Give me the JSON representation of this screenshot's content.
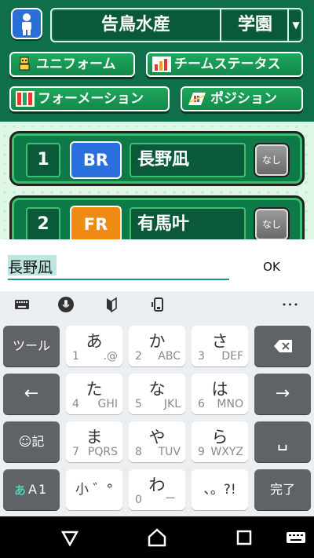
{
  "team": {
    "name": "告鳥水産",
    "division": "学園",
    "dropdown_glyph": "▼"
  },
  "menu": {
    "uniform": "ユニフォーム",
    "team_status": "チームステータス",
    "formation": "フォーメーション",
    "position": "ポジション"
  },
  "players": [
    {
      "number": "1",
      "position": "BR",
      "position_color": "#2a6fe0",
      "name": "長野凪",
      "none_label": "なし"
    },
    {
      "number": "2",
      "position": "FR",
      "position_color": "#ef8a12",
      "name": "有馬叶",
      "none_label": "なし"
    }
  ],
  "input": {
    "value": "長野凪",
    "ok_label": "OK"
  },
  "keyboard": {
    "tools_label": "ツール",
    "more_glyph": "•••",
    "rows": [
      [
        {
          "main": "あ",
          "num": "1",
          "sub": ".@"
        },
        {
          "main": "か",
          "num": "2",
          "sub": "ABC"
        },
        {
          "main": "さ",
          "num": "3",
          "sub": "DEF"
        }
      ],
      [
        {
          "main": "た",
          "num": "4",
          "sub": "GHI"
        },
        {
          "main": "な",
          "num": "5",
          "sub": "JKL"
        },
        {
          "main": "は",
          "num": "6",
          "sub": "MNO"
        }
      ],
      [
        {
          "main": "ま",
          "num": "7",
          "sub": "PQRS"
        },
        {
          "main": "や",
          "num": "8",
          "sub": "TUV"
        },
        {
          "main": "ら",
          "num": "9",
          "sub": "WXYZ"
        }
      ]
    ],
    "bottom": {
      "small": "小 ゛°",
      "wa_main": "わ",
      "wa_num": "0",
      "wa_sub": "ー",
      "punct": "、。?!",
      "done": "完了",
      "mode_kana": "あ",
      "mode_alpha": "A",
      "mode_num": "1",
      "emoji_label": "☺記",
      "space_glyph": "␣",
      "left_arrow": "←",
      "right_arrow": "→"
    }
  },
  "colors": {
    "header_green": "#0f6f4a",
    "button_green": "#1ea85c",
    "accent_teal": "#199a8a"
  }
}
